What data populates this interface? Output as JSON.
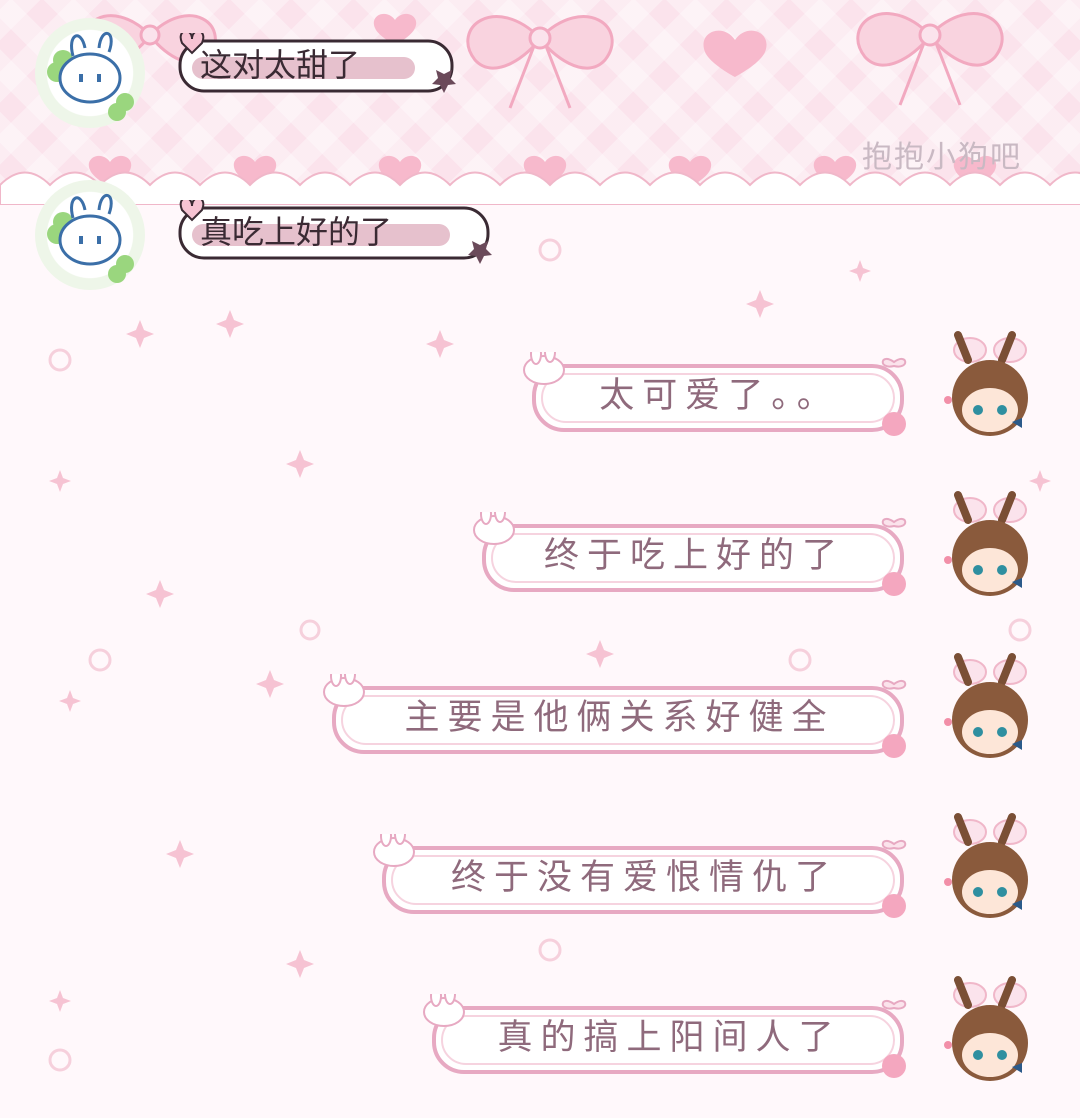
{
  "watermark": "抱抱小狗吧",
  "incoming": [
    {
      "text": "这对太甜了"
    },
    {
      "text": "真吃上好的了"
    }
  ],
  "outgoing": [
    {
      "text": "太可爱了。。"
    },
    {
      "text": "终于吃上好的了"
    },
    {
      "text": "主要是他俩关系好健全"
    },
    {
      "text": "终于没有爱恨情仇了"
    },
    {
      "text": "真的搞上阳间人了"
    }
  ],
  "colors": {
    "banner": "#fbe3ec",
    "bubble_border": "#e7a9c2",
    "text_out": "#8f6a7c",
    "text_in": "#3a2a33",
    "sparkle": "#f6c3d3"
  },
  "icons": {
    "incoming_avatar": "bunny-clover-avatar-icon",
    "outgoing_avatar": "brown-hair-bunny-ears-girl-avatar-icon",
    "banner_ribbon": "bow-ribbon-icon",
    "banner_heart": "heart-icon"
  }
}
